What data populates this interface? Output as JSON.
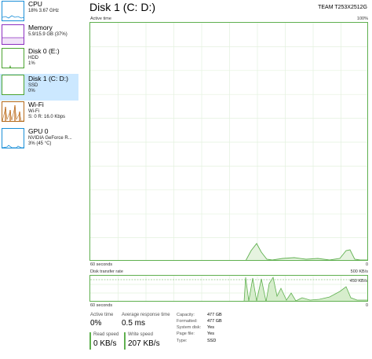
{
  "sidebar": {
    "items": [
      {
        "title": "CPU",
        "sub1": "18% 3.67 GHz",
        "sub2": "",
        "color": "#1a8fd8"
      },
      {
        "title": "Memory",
        "sub1": "5.9/15.9 GB (37%)",
        "sub2": "",
        "color": "#8b2fc0"
      },
      {
        "title": "Disk 0 (E:)",
        "sub1": "HDD",
        "sub2": "1%",
        "color": "#4aa32f"
      },
      {
        "title": "Disk 1 (C: D:)",
        "sub1": "SSD",
        "sub2": "0%",
        "color": "#4aa32f"
      },
      {
        "title": "Wi-Fi",
        "sub1": "Wi-Fi",
        "sub2": "S: 0 R: 16.0 Kbps",
        "color": "#b3691a"
      },
      {
        "title": "GPU 0",
        "sub1": "NVIDIA GeForce R...",
        "sub2": "3% (45 °C)",
        "color": "#1a8fd8"
      }
    ],
    "selected_index": 3
  },
  "main": {
    "title": "Disk 1 (C: D:)",
    "model": "TEAM T253X2512G",
    "active_time_label": "Active time",
    "active_time_max": "100%",
    "sixty_seconds": "60 seconds",
    "zero": "0",
    "transfer_rate_label": "Disk transfer rate",
    "transfer_rate_max": "500 KB/s",
    "transfer_rate_mid": "450 KB/s",
    "accent": "#5fb04f"
  },
  "stats": {
    "active_time_label": "Active time",
    "active_time_value": "0%",
    "avg_response_label": "Average response time",
    "avg_response_value": "0.5 ms",
    "read_speed_label": "Read speed",
    "read_speed_value": "0 KB/s",
    "write_speed_label": "Write speed",
    "write_speed_value": "207 KB/s"
  },
  "info": {
    "capacity_label": "Capacity:",
    "capacity_value": "477 GB",
    "formatted_label": "Formatted:",
    "formatted_value": "477 GB",
    "system_disk_label": "System disk:",
    "system_disk_value": "Yes",
    "page_file_label": "Page file:",
    "page_file_value": "Yes",
    "type_label": "Type:",
    "type_value": "SSD"
  }
}
